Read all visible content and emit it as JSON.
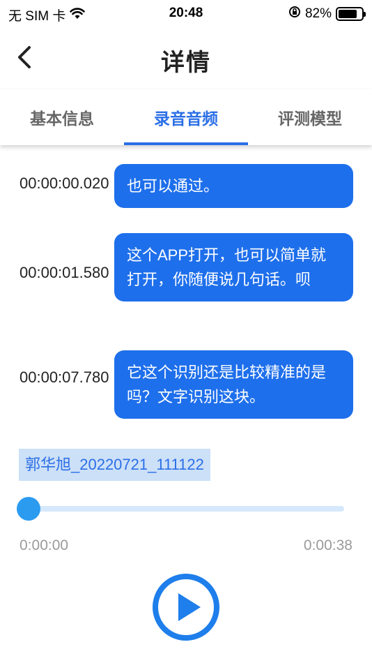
{
  "status_bar": {
    "carrier": "无 SIM 卡",
    "time": "20:48",
    "battery_percent": "82%",
    "battery_level": 0.82
  },
  "nav": {
    "title": "详情"
  },
  "tabs": [
    {
      "label": "基本信息",
      "active": false
    },
    {
      "label": "录音音频",
      "active": true
    },
    {
      "label": "评测模型",
      "active": false
    }
  ],
  "transcript": [
    {
      "time": "00:00:00.020",
      "text": "也可以通过。"
    },
    {
      "time": "00:00:01.580",
      "text": "这个APP打开，也可以简单就打开，你随便说几句话。呗"
    },
    {
      "time": "00:00:07.780",
      "text": "它这个识别还是比较精准的是吗？文字识别这块。"
    }
  ],
  "player": {
    "file_name": "郭华旭_20220721_111122",
    "current_time": "0:00:00",
    "total_time": "0:00:38",
    "progress": 0.0
  },
  "colors": {
    "accent": "#2B6FE6",
    "bubble": "#1E6FEB",
    "slider_thumb": "#2B9BF0",
    "slider_track": "#D6E8FB",
    "file_label_bg": "#CCE0F8"
  },
  "icons": {
    "back": "chevron-left-icon",
    "wifi": "wifi-icon",
    "orientation_lock": "orientation-lock-icon",
    "battery": "battery-icon",
    "play": "play-icon"
  }
}
